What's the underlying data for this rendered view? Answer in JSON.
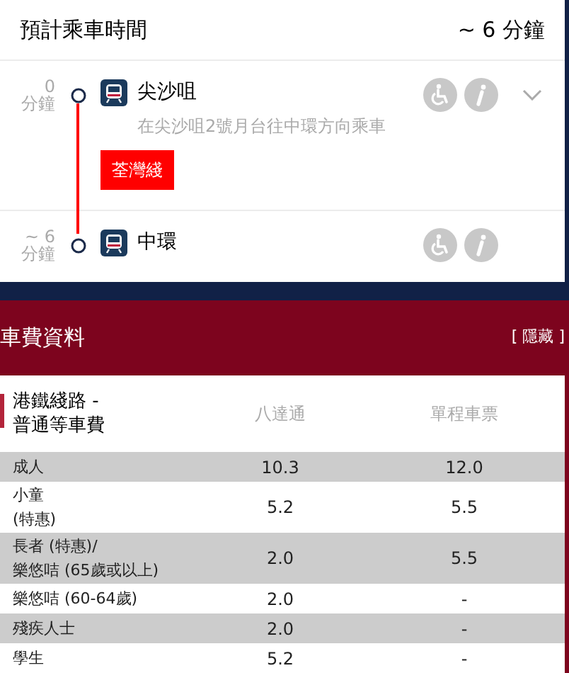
{
  "journey": {
    "title": "預計乘車時間",
    "duration": "~ 6 分鐘"
  },
  "stations": [
    {
      "time": "0",
      "unit": "分鐘",
      "name": "尖沙咀",
      "note": "在尖沙咀2號月台往中環方向乘車",
      "line": {
        "name": "荃灣綫",
        "color": "#ff0000"
      },
      "expanded": false
    },
    {
      "time": "~ 6",
      "unit": "分鐘",
      "name": "中環"
    }
  ],
  "fares": {
    "title": "車費資料",
    "toggle": "[ 隱藏 ]",
    "columns": [
      "港鐵綫路 -\n普通等車費",
      "八達通",
      "單程車票"
    ],
    "rows": [
      [
        "成人",
        "10.3",
        "12.0"
      ],
      [
        "小童\n(特惠)",
        "5.2",
        "5.5"
      ],
      [
        "長者 (特惠)/\n樂悠咭 (65歲或以上)",
        "2.0",
        "5.5"
      ],
      [
        "樂悠咭 (60-64歲)",
        "2.0",
        "-"
      ],
      [
        "殘疾人士",
        "2.0",
        "-"
      ],
      [
        "學生",
        "5.2",
        "-"
      ]
    ]
  }
}
